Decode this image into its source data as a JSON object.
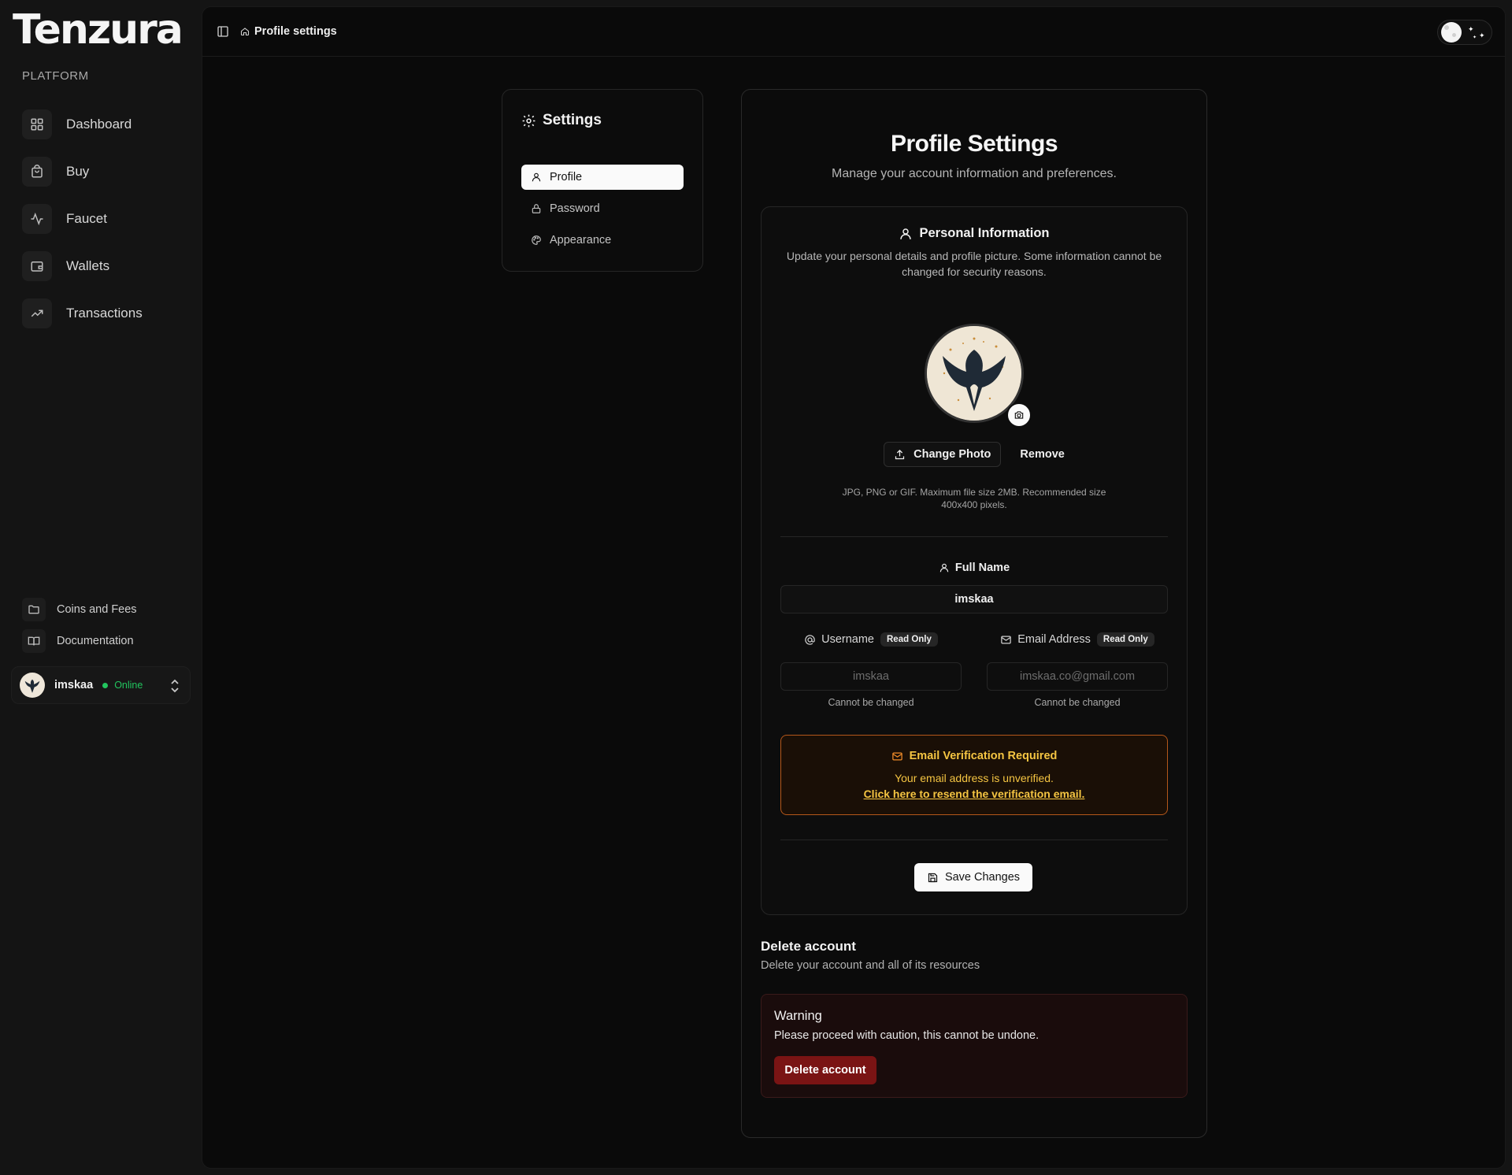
{
  "app": {
    "logo": "Tenzura",
    "section_label": "PLATFORM"
  },
  "sidebar": {
    "items": [
      {
        "label": "Dashboard",
        "icon": "grid-icon"
      },
      {
        "label": "Buy",
        "icon": "shopping-bag-icon"
      },
      {
        "label": "Faucet",
        "icon": "activity-icon"
      },
      {
        "label": "Wallets",
        "icon": "wallet-icon"
      },
      {
        "label": "Transactions",
        "icon": "trending-up-icon"
      }
    ],
    "secondary": [
      {
        "label": "Coins and Fees",
        "icon": "folder-icon"
      },
      {
        "label": "Documentation",
        "icon": "book-icon"
      }
    ],
    "user": {
      "name": "imskaa",
      "status": "Online"
    }
  },
  "topbar": {
    "breadcrumb": "Profile settings"
  },
  "settings_nav": {
    "title": "Settings",
    "items": [
      {
        "label": "Profile",
        "active": true
      },
      {
        "label": "Password",
        "active": false
      },
      {
        "label": "Appearance",
        "active": false
      }
    ]
  },
  "profile": {
    "title": "Profile Settings",
    "subtitle": "Manage your account information and preferences.",
    "personal": {
      "title": "Personal Information",
      "description": "Update your personal details and profile picture. Some information cannot be changed for security reasons.",
      "change_photo": "Change Photo",
      "remove": "Remove",
      "photo_hint": "JPG, PNG or GIF. Maximum file size 2MB. Recommended size 400x400 pixels."
    },
    "full_name": {
      "label": "Full Name",
      "value": "imskaa"
    },
    "username": {
      "label": "Username",
      "badge": "Read Only",
      "value": "imskaa",
      "note": "Cannot be changed"
    },
    "email": {
      "label": "Email Address",
      "badge": "Read Only",
      "value": "imskaa.co@gmail.com",
      "note": "Cannot be changed"
    },
    "verification": {
      "title": "Email Verification Required",
      "message": "Your email address is unverified.",
      "link": "Click here to resend the verification email."
    },
    "save": "Save Changes",
    "delete": {
      "title": "Delete account",
      "subtitle": "Delete your account and all of its resources",
      "warning_title": "Warning",
      "warning_text": "Please proceed with caution, this cannot be undone.",
      "button": "Delete account"
    }
  },
  "colors": {
    "warning_amber": "#f5c542",
    "warning_border": "#b4571a",
    "danger": "#7a1414",
    "online": "#22c55e"
  }
}
